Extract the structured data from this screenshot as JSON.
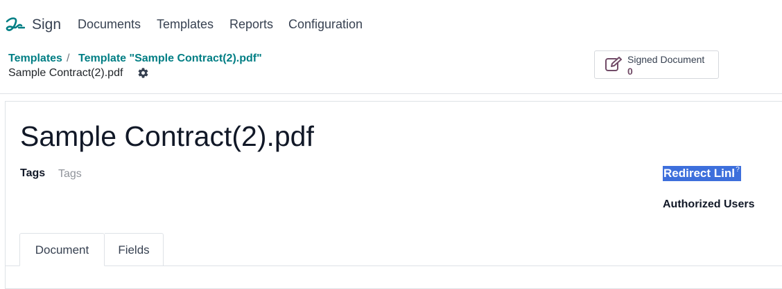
{
  "navbar": {
    "app_icon": "sign-signature-icon",
    "app_name": "Sign",
    "menu": [
      "Documents",
      "Templates",
      "Reports",
      "Configuration"
    ]
  },
  "breadcrumb": {
    "items": [
      "Templates",
      "Template \"Sample Contract(2).pdf\""
    ],
    "separator": "/",
    "current": "Sample Contract(2).pdf",
    "settings_icon": "gear-icon"
  },
  "stat_button": {
    "icon": "signed-document-icon",
    "label": "Signed Document",
    "value": "0"
  },
  "form": {
    "title": "Sample Contract(2).pdf",
    "tags_label": "Tags",
    "tags_placeholder": "Tags",
    "redirect_label": "Redirect Link",
    "help_mark": "?",
    "authorized_label": "Authorized Users"
  },
  "tabs": [
    {
      "label": "Document",
      "active": true
    },
    {
      "label": "Fields",
      "active": false
    }
  ],
  "colors": {
    "brand_teal": "#017e84",
    "accent_purple": "#714b67",
    "selection_blue": "#3d6fdc"
  }
}
